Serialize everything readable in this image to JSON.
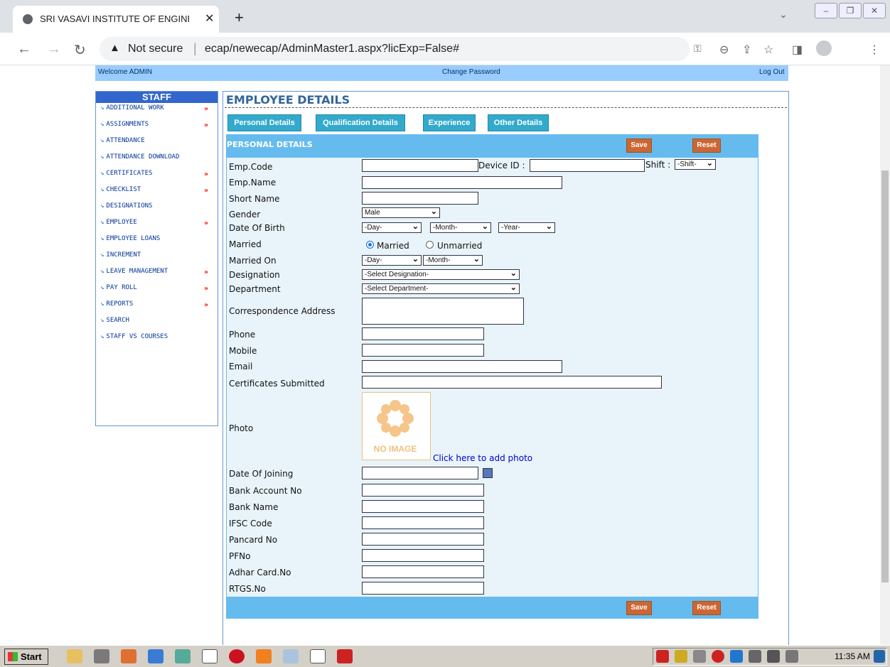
{
  "browser": {
    "tab_title": "SRI VASAVI INSTITUTE OF ENGINE",
    "tab_close": "✕",
    "new_tab": "+",
    "security_label": "Not secure",
    "url": "ecap/newecap/AdminMaster1.aspx?licExp=False#"
  },
  "topbar": {
    "welcome": "Welcome ADMIN",
    "change_password": "Change Password",
    "logout": "Log Out"
  },
  "sidebar": {
    "header": "STAFF",
    "items": [
      {
        "label": "ADDITIONAL WORK",
        "more": "»"
      },
      {
        "label": "ASSIGNMENTS",
        "more": "»"
      },
      {
        "label": "ATTENDANCE",
        "more": ""
      },
      {
        "label": "ATTENDANCE DOWNLOAD",
        "more": ""
      },
      {
        "label": "CERTIFICATES",
        "more": "»"
      },
      {
        "label": "CHECKLIST",
        "more": "»"
      },
      {
        "label": "DESIGNATIONS",
        "more": ""
      },
      {
        "label": "EMPLOYEE",
        "more": "»"
      },
      {
        "label": "EMPLOYEE LOANS",
        "more": ""
      },
      {
        "label": "INCREMENT",
        "more": ""
      },
      {
        "label": "LEAVE MANAGEMENT",
        "more": "»"
      },
      {
        "label": "PAY ROLL",
        "more": "»"
      },
      {
        "label": "REPORTS",
        "more": "»"
      },
      {
        "label": "SEARCH",
        "more": ""
      },
      {
        "label": "STAFF VS COURSES",
        "more": ""
      }
    ]
  },
  "main": {
    "heading": "EMPLOYEE DETAILS",
    "tabs": [
      "Personal Details",
      "Qualification Details",
      "Experience",
      "Other Details"
    ],
    "section_title": "PERSONAL DETAILS",
    "save": "Save",
    "reset": "Reset"
  },
  "form": {
    "emp_code": "Emp.Code",
    "device_id": "Device ID :",
    "shift_label": "Shift :",
    "shift_value": "-Shift-",
    "emp_name": "Emp.Name",
    "short_name": "Short Name",
    "gender": "Gender",
    "gender_value": "Male",
    "dob": "Date Of Birth",
    "day": "-Day-",
    "month": "-Month-",
    "year": "-Year-",
    "married": "Married",
    "opt_married": "Married",
    "opt_unmarried": "Unmarried",
    "married_on": "Married On",
    "designation": "Designation",
    "designation_value": "-Select Designation-",
    "department": "Department",
    "department_value": "-Select Department-",
    "address": "Correspondence Address",
    "phone": "Phone",
    "mobile": "Mobile",
    "email": "Email",
    "certificates": "Certificates Submitted",
    "photo": "Photo",
    "no_image": "NO IMAGE",
    "add_photo": "Click here to add photo",
    "doj": "Date Of Joining",
    "bank_account": "Bank Account No",
    "bank_name": "Bank Name",
    "ifsc": "IFSC Code",
    "pancard": "Pancard No",
    "pfno": "PFNo",
    "adhar": "Adhar Card.No",
    "rtgs": "RTGS.No"
  },
  "taskbar": {
    "start": "Start",
    "clock": "11:35 AM"
  }
}
